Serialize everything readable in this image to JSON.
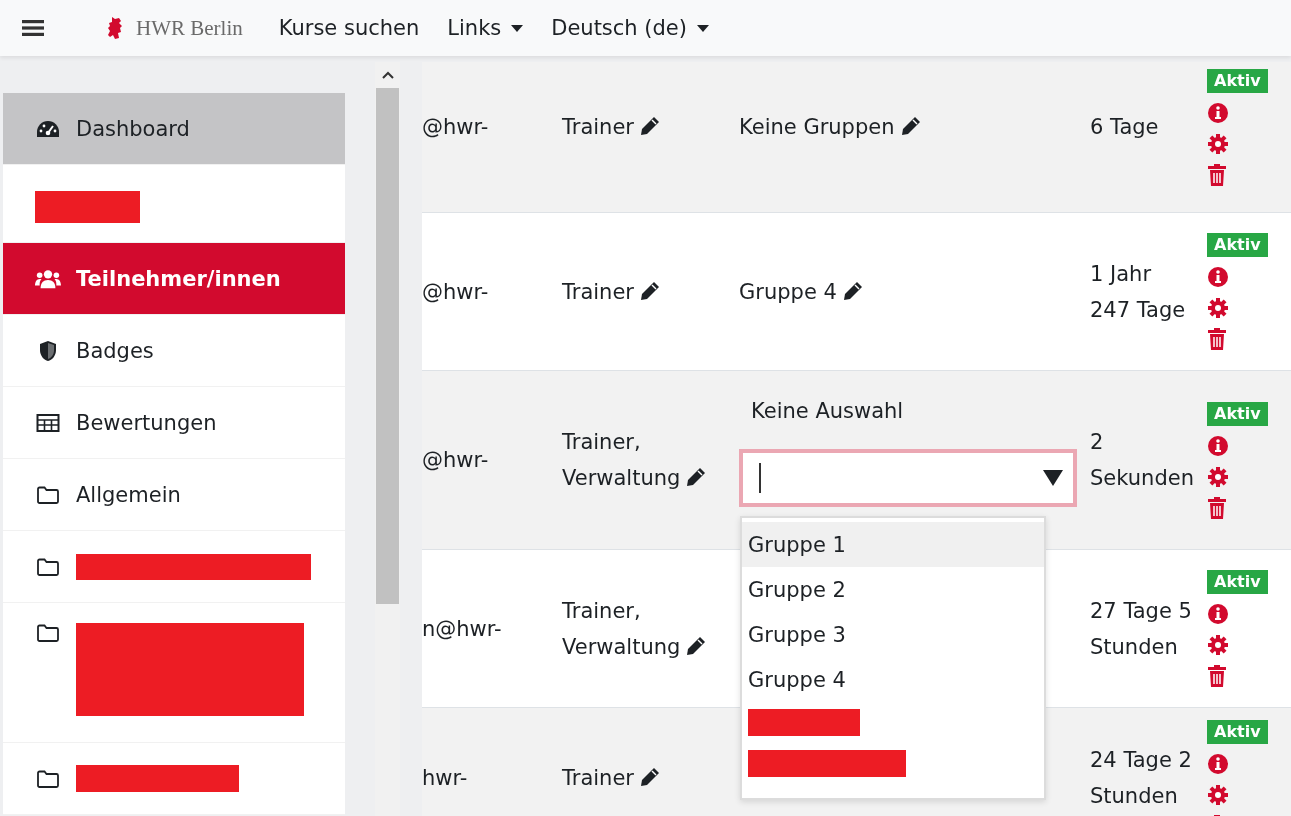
{
  "navbar": {
    "brand": "HWR Berlin",
    "links": [
      {
        "label": "Kurse suchen",
        "dropdown": false
      },
      {
        "label": "Links",
        "dropdown": true
      },
      {
        "label": "Deutsch (de)",
        "dropdown": true
      }
    ]
  },
  "sidebar": {
    "items": [
      {
        "kind": "link",
        "label": "Dashboard",
        "selected": false,
        "highlighted": true
      },
      {
        "kind": "redacted",
        "selected": false,
        "highlighted": false
      },
      {
        "kind": "link",
        "label": "Teilnehmer/innen",
        "selected": true,
        "highlighted": false
      },
      {
        "kind": "link",
        "label": "Badges",
        "selected": false,
        "highlighted": false
      },
      {
        "kind": "link",
        "label": "Bewertungen",
        "selected": false,
        "highlighted": false
      },
      {
        "kind": "link",
        "label": "Allgemein",
        "selected": false,
        "highlighted": false
      },
      {
        "kind": "redacted",
        "selected": false,
        "highlighted": false
      },
      {
        "kind": "redacted",
        "selected": false,
        "highlighted": false
      },
      {
        "kind": "redacted",
        "selected": false,
        "highlighted": false
      }
    ]
  },
  "table": {
    "rows": [
      {
        "email": "@hwr-",
        "roles": [
          "Trainer"
        ],
        "group": {
          "kind": "text",
          "label": "Keine Gruppen"
        },
        "time": [
          "6 Tage"
        ],
        "status": "Aktiv"
      },
      {
        "email": "@hwr-",
        "roles": [
          "Trainer"
        ],
        "group": {
          "kind": "text",
          "label": "Gruppe 4"
        },
        "time": [
          "1 Jahr",
          "247 Tage"
        ],
        "status": "Aktiv"
      },
      {
        "email": "@hwr-",
        "roles": [
          "Trainer,",
          "Verwaltung"
        ],
        "group": {
          "kind": "editor",
          "label": "Keine Auswahl"
        },
        "time": [
          "2",
          "Sekunden"
        ],
        "status": "Aktiv"
      },
      {
        "email": "n@hwr-",
        "roles": [
          "Trainer,",
          "Verwaltung"
        ],
        "group": {
          "kind": "hidden"
        },
        "time": [
          "27 Tage 5",
          "Stunden"
        ],
        "status": "Aktiv"
      },
      {
        "email": "hwr-",
        "roles": [
          "Trainer"
        ],
        "group": {
          "kind": "hidden"
        },
        "time": [
          "24 Tage 2",
          "Stunden"
        ],
        "status": "Aktiv"
      }
    ]
  },
  "dropdown": {
    "options": [
      {
        "kind": "text",
        "label": "Gruppe 1",
        "selected": true
      },
      {
        "kind": "text",
        "label": "Gruppe 2",
        "selected": false
      },
      {
        "kind": "text",
        "label": "Gruppe 3",
        "selected": false
      },
      {
        "kind": "text",
        "label": "Gruppe 4",
        "selected": false
      },
      {
        "kind": "redacted",
        "selected": false
      },
      {
        "kind": "redacted",
        "selected": false
      }
    ]
  }
}
